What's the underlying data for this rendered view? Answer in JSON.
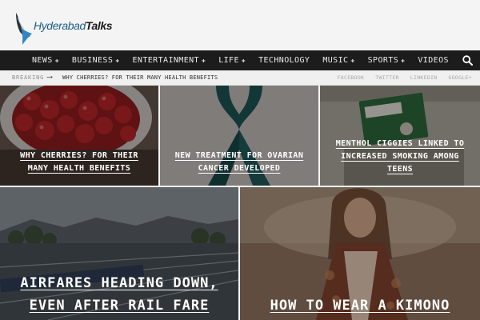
{
  "brand": {
    "name_part1": "Hyderabad",
    "name_part2": "Talks"
  },
  "nav": {
    "items": [
      {
        "label": "NEWS",
        "has_submenu": true
      },
      {
        "label": "BUSINESS",
        "has_submenu": true
      },
      {
        "label": "ENTERTAINMENT",
        "has_submenu": true
      },
      {
        "label": "LIFE",
        "has_submenu": true
      },
      {
        "label": "TECHNOLOGY",
        "has_submenu": false
      },
      {
        "label": "MUSIC",
        "has_submenu": true
      },
      {
        "label": "SPORTS",
        "has_submenu": true
      },
      {
        "label": "VIDEOS",
        "has_submenu": false
      }
    ],
    "submenu_indicator": "✚",
    "search_icon": "search-icon"
  },
  "breaking": {
    "label": "BREAKING",
    "arrow": "⟶",
    "headline": "WHY CHERRIES? FOR THEIR MANY HEALTH BENEFITS"
  },
  "social": [
    "FACEBOOK",
    "TWITTER",
    "LINKEDIN",
    "GOOGLE+"
  ],
  "featured_small": [
    {
      "title": "WHY CHERRIES? FOR THEIR MANY HEALTH BENEFITS",
      "image": "cherries"
    },
    {
      "title": "NEW TREATMENT FOR OVARIAN CANCER DEVELOPED",
      "image": "teal-ribbon"
    },
    {
      "title": "MENTHOL CIGGIES LINKED TO INCREASED SMOKING AMONG TEENS",
      "image": "cigarette-pack"
    }
  ],
  "featured_large": [
    {
      "title": "AIRFARES HEADING DOWN, EVEN AFTER RAIL FARE",
      "image": "railway-yard"
    },
    {
      "title": "HOW TO WEAR A KIMONO",
      "image": "woman-in-kimono"
    }
  ],
  "colors": {
    "nav_bg": "#1c1c1c",
    "brand_blue": "#1c5f8c",
    "ribbon_teal": "#1f5a5a"
  }
}
